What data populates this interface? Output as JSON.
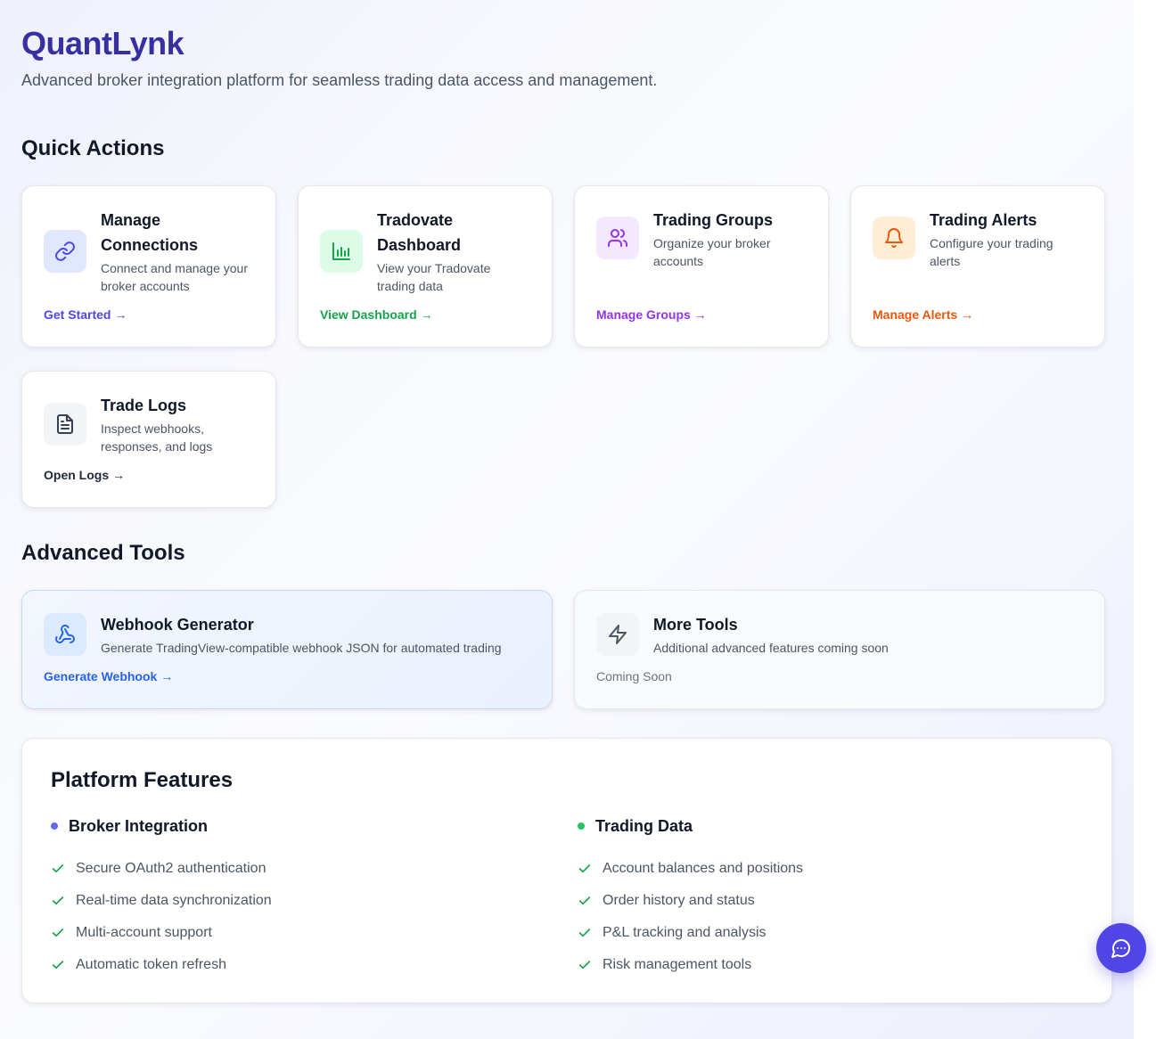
{
  "header": {
    "brand": "QuantLynk",
    "tagline": "Advanced broker integration platform for seamless trading data access and management."
  },
  "quick_actions": {
    "title": "Quick Actions",
    "cards": [
      {
        "title": "Manage Connections",
        "desc": "Connect and manage your broker accounts",
        "link": "Get Started →",
        "icon": "link-icon",
        "color": "#4f46e5",
        "icon_bg": "#e0e7ff"
      },
      {
        "title": "Tradovate Dashboard",
        "desc": "View your Tradovate trading data",
        "link": "View Dashboard →",
        "icon": "bar-chart-icon",
        "color": "#16a34a",
        "icon_bg": "#dcfce7"
      },
      {
        "title": "Trading Groups",
        "desc": "Organize your broker accounts",
        "link": "Manage Groups →",
        "icon": "users-icon",
        "color": "#9333ea",
        "icon_bg": "#f3e8ff"
      },
      {
        "title": "Trading Alerts",
        "desc": "Configure your trading alerts",
        "link": "Manage Alerts →",
        "icon": "bell-icon",
        "color": "#ea580c",
        "icon_bg": "#ffedd5"
      },
      {
        "title": "Trade Logs",
        "desc": "Inspect webhooks, responses, and logs",
        "link": "Open Logs →",
        "icon": "file-text-icon",
        "color": "#374151",
        "icon_bg": "#f3f4f6"
      }
    ]
  },
  "advanced_tools": {
    "title": "Advanced Tools",
    "cards": [
      {
        "title": "Webhook Generator",
        "desc": "Generate TradingView-compatible webhook JSON for automated trading",
        "link": "Generate Webhook →",
        "icon": "webhook-icon",
        "color": "#2563eb",
        "icon_bg": "#dbeafe"
      },
      {
        "title": "More Tools",
        "desc": "Additional advanced features coming soon",
        "link": "Coming Soon",
        "icon": "zap-icon",
        "color": "#4b5563",
        "icon_bg": "#f3f4f6"
      }
    ]
  },
  "features": {
    "title": "Platform Features",
    "columns": [
      {
        "heading": "Broker Integration",
        "dot_color": "#6366f1",
        "items": [
          "Secure OAuth2 authentication",
          "Real-time data synchronization",
          "Multi-account support",
          "Automatic token refresh"
        ]
      },
      {
        "heading": "Trading Data",
        "dot_color": "#22c55e",
        "items": [
          "Account balances and positions",
          "Order history and status",
          "P&L tracking and analysis",
          "Risk management tools"
        ]
      }
    ],
    "check_color": "#16a34a"
  },
  "chat": {
    "icon": "chat-bubble-icon",
    "color": "#4f46e5"
  }
}
